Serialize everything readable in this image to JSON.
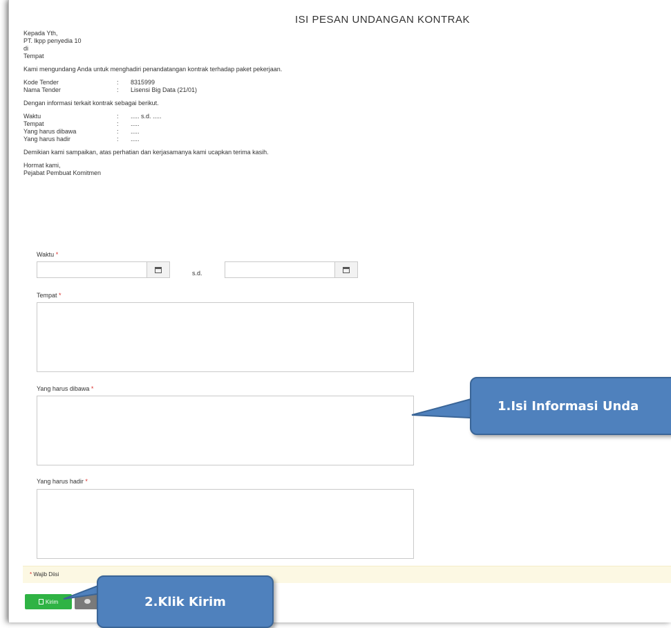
{
  "title": "ISI PESAN UNDANGAN KONTRAK",
  "letter": {
    "to": "Kepada Yth,",
    "company": "PT. lkpp penyedia 10",
    "di": "di",
    "tempat": "Tempat",
    "intro": "Kami mengundang Anda untuk menghadiri penandatangan kontrak terhadap paket pekerjaan.",
    "kode_label": "Kode Tender",
    "kode_value": "8315999",
    "nama_label": "Nama Tender",
    "nama_value": "Lisensi Big Data (21/01)",
    "info_intro": "Dengan informasi terkait kontrak sebagai berikut.",
    "waktu_label": "Waktu",
    "waktu_value": "..... s.d. .....",
    "tempat_label": "Tempat",
    "tempat_value": ".....",
    "dibawa_label": "Yang harus dibawa",
    "dibawa_value": ".....",
    "hadir_label": "Yang harus hadir",
    "hadir_value": ".....",
    "sep": ":",
    "closing": "Demikian kami sampaikan, atas perhatian dan kerjasamanya kami ucapkan terima kasih.",
    "regards": "Hormat kami,",
    "signer": "Pejabat Pembuat Komitmen"
  },
  "form": {
    "waktu_label": "Waktu",
    "sd_label": "s.d.",
    "tempat_label": "Tempat",
    "dibawa_label": "Yang harus dibawa",
    "hadir_label": "Yang harus hadir",
    "required_mark": "*",
    "waktu_start_value": "",
    "waktu_end_value": "",
    "tempat_value": "",
    "dibawa_value": "",
    "hadir_value": ""
  },
  "note": {
    "mark": "*",
    "text": "Wajib Diisi"
  },
  "buttons": {
    "kirim": "Kirim"
  },
  "callouts": {
    "step1": "1.Isi Informasi Unda",
    "step2": "2.Klik Kirim"
  },
  "colors": {
    "kirim_button": "#2fb344",
    "callout": "#4f81bd",
    "required": "#d9302c",
    "note_bar": "#fcf8e3"
  },
  "icons": {
    "calendar": "calendar-icon",
    "save": "save-icon",
    "eye": "eye-icon",
    "resize": "resize-grip-icon"
  }
}
